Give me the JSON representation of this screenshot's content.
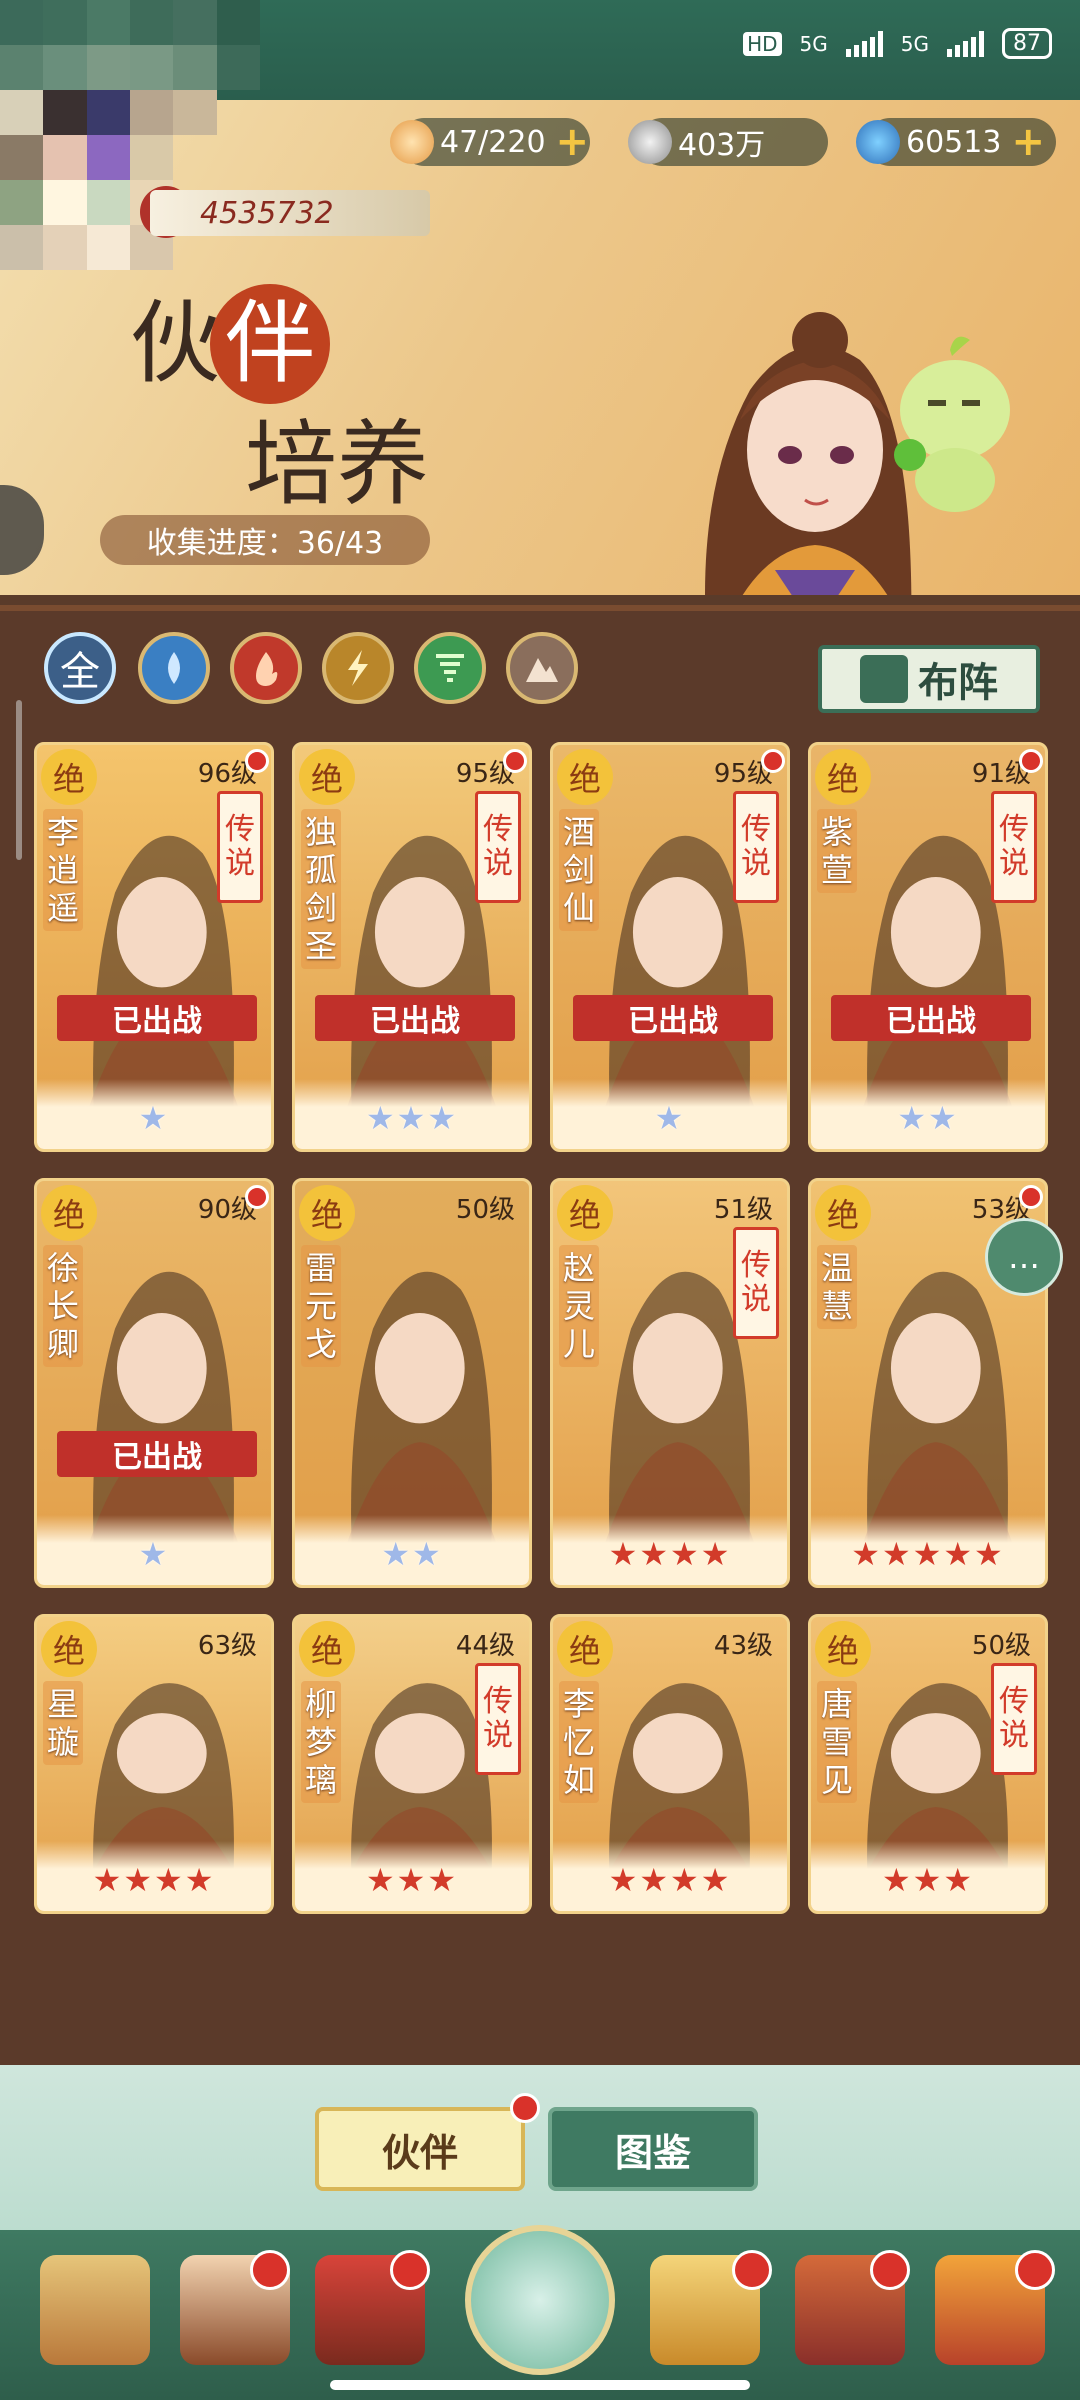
{
  "status": {
    "hd": "HD",
    "net1": "5G",
    "net2": "5G",
    "battery": "87"
  },
  "resources": [
    {
      "icon": "bun-icon",
      "value": "47/220",
      "has_plus": true
    },
    {
      "icon": "coin-icon",
      "value": "403万",
      "has_plus": false
    },
    {
      "icon": "gem-icon",
      "value": "60513",
      "has_plus": true
    }
  ],
  "banner": {
    "power_label": "战",
    "power_value": "4535732",
    "title_left": "伙",
    "title_ball": "伴",
    "title_line2": "培养",
    "collection": "收集进度：36/43"
  },
  "filters": [
    {
      "name": "all",
      "label": "全",
      "color": "#3c5f88",
      "selected": true
    },
    {
      "name": "water",
      "label": "",
      "color": "#3a7fc3",
      "selected": false
    },
    {
      "name": "fire",
      "label": "",
      "color": "#c0392b",
      "selected": false
    },
    {
      "name": "thunder",
      "label": "",
      "color": "#b9862a",
      "selected": false
    },
    {
      "name": "wind",
      "label": "",
      "color": "#3d9a52",
      "selected": false
    },
    {
      "name": "earth",
      "label": "",
      "color": "#8a6e5c",
      "selected": false
    }
  ],
  "lineup_label": "布阵",
  "cards": [
    {
      "name": "李逍遥",
      "level": "96级",
      "tier": "绝",
      "legend": "传说",
      "out": "已出战",
      "stars": 1,
      "star_color": "blue",
      "bg": "#f4c46c",
      "dot": true
    },
    {
      "name": "独孤剑圣",
      "level": "95级",
      "tier": "绝",
      "legend": "传说",
      "out": "已出战",
      "stars": 3,
      "star_color": "blue",
      "bg": "#f2c97a",
      "dot": true
    },
    {
      "name": "酒剑仙",
      "level": "95级",
      "tier": "绝",
      "legend": "传说",
      "out": "已出战",
      "stars": 1,
      "star_color": "blue",
      "bg": "#eab86a",
      "dot": true
    },
    {
      "name": "紫萱",
      "level": "91级",
      "tier": "绝",
      "legend": "传说",
      "out": "已出战",
      "stars": 2,
      "star_color": "blue",
      "bg": "#e9b569",
      "dot": true
    },
    {
      "name": "徐长卿",
      "level": "90级",
      "tier": "绝",
      "legend": "",
      "out": "已出战",
      "stars": 1,
      "star_color": "blue",
      "bg": "#eab86a",
      "dot": true
    },
    {
      "name": "雷元戈",
      "level": "50级",
      "tier": "绝",
      "legend": "",
      "out": "",
      "stars": 2,
      "star_color": "blue",
      "bg": "#e2ad5c",
      "dot": false
    },
    {
      "name": "赵灵儿",
      "level": "51级",
      "tier": "绝",
      "legend": "传说",
      "out": "",
      "stars": 4,
      "star_color": "red",
      "bg": "#f2c57a",
      "dot": false
    },
    {
      "name": "温慧",
      "level": "53级",
      "tier": "绝",
      "legend": "",
      "out": "",
      "stars": 5,
      "star_color": "red",
      "bg": "#f0c272",
      "dot": true
    },
    {
      "name": "星璇",
      "level": "63级",
      "tier": "绝",
      "legend": "",
      "out": "",
      "stars": 4,
      "star_color": "red",
      "bg": "#f4cd82",
      "dot": false
    },
    {
      "name": "柳梦璃",
      "level": "44级",
      "tier": "绝",
      "legend": "传说",
      "out": "",
      "stars": 3,
      "star_color": "red",
      "bg": "#f3cf8a",
      "dot": false
    },
    {
      "name": "李忆如",
      "level": "43级",
      "tier": "绝",
      "legend": "",
      "out": "",
      "stars": 4,
      "star_color": "red",
      "bg": "#f1c174",
      "dot": false
    },
    {
      "name": "唐雪见",
      "level": "50级",
      "tier": "绝",
      "legend": "传说",
      "out": "",
      "stars": 3,
      "star_color": "red",
      "bg": "#f1c174",
      "dot": false
    }
  ],
  "tabs": {
    "companion": "伙伴",
    "codex": "图鉴"
  },
  "nav": [
    "scroll-map-icon",
    "hero-avatar-icon",
    "palace-icon",
    "home-orb-icon",
    "gourd-icon",
    "cards-icon",
    "gift-icon"
  ]
}
